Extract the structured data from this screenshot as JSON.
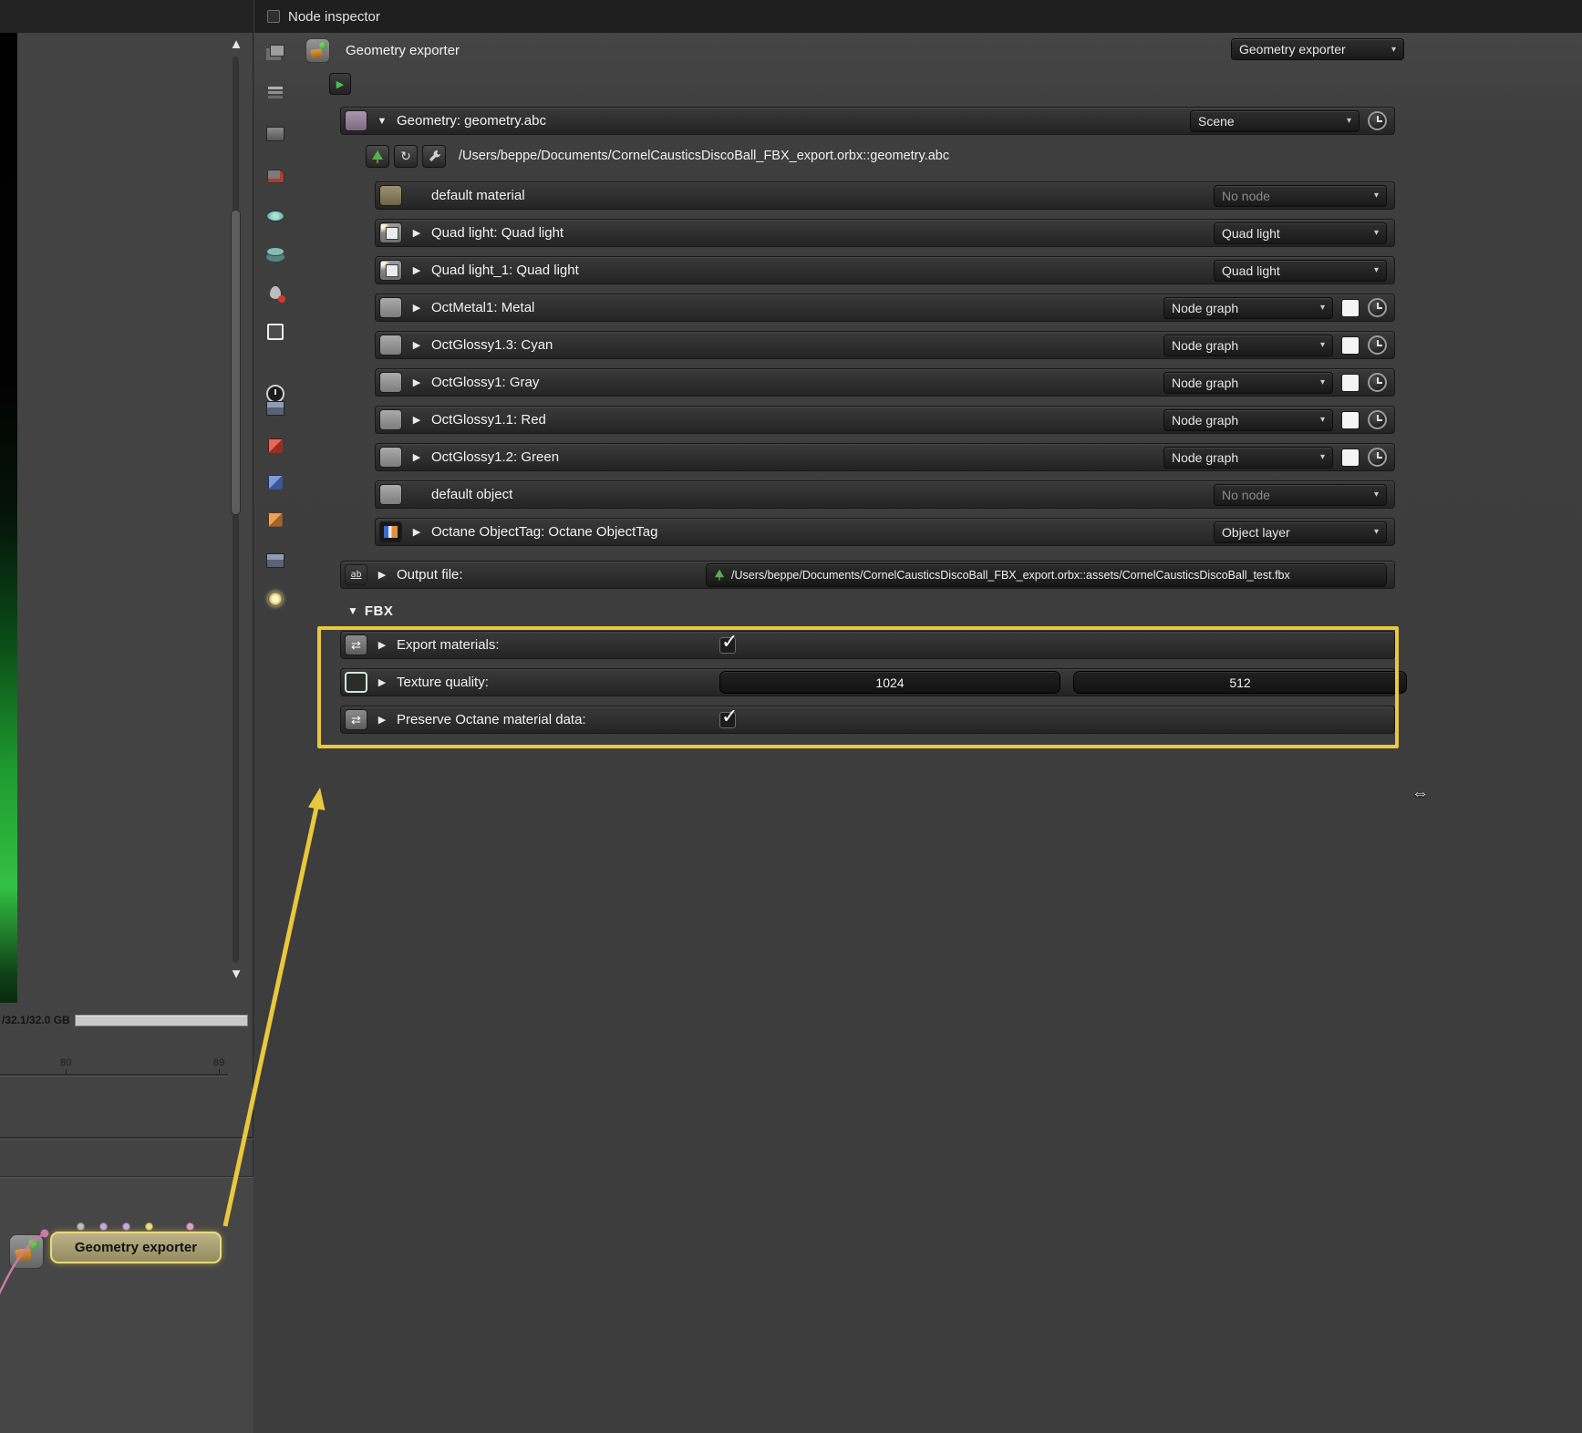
{
  "glyphs": {
    "expand_open": "▼",
    "expand_closed": "▶",
    "caret": "▾",
    "check": "✓",
    "scroll_up": "▲",
    "scroll_down": "▼",
    "play": "▶",
    "refresh": "↻",
    "cursor": "⇔"
  },
  "titlebar": {
    "title": "Node inspector"
  },
  "header": {
    "label": "Geometry exporter",
    "type_value": "Geometry exporter"
  },
  "geometry": {
    "label": "Geometry: geometry.abc",
    "value": "Scene",
    "path": "/Users/beppe/Documents/CornelCausticsDiscoBall_FBX_export.orbx::geometry.abc"
  },
  "children": [
    {
      "label": "default material",
      "value": "No node"
    },
    {
      "label": "Quad light: Quad light",
      "value": "Quad light"
    },
    {
      "label": "Quad light_1: Quad light",
      "value": "Quad light"
    },
    {
      "label": "OctMetal1: Metal",
      "value": "Node graph"
    },
    {
      "label": "OctGlossy1.3: Cyan",
      "value": "Node graph"
    },
    {
      "label": "OctGlossy1: Gray",
      "value": "Node graph"
    },
    {
      "label": "OctGlossy1.1: Red",
      "value": "Node graph"
    },
    {
      "label": "OctGlossy1.2: Green",
      "value": "Node graph"
    },
    {
      "label": "default object",
      "value": "No node"
    },
    {
      "label": "Octane ObjectTag: Octane ObjectTag",
      "value": "Object layer"
    }
  ],
  "output_file": {
    "label": "Output file:",
    "path": "/Users/beppe/Documents/CornelCausticsDiscoBall_FBX_export.orbx::assets/CornelCausticsDiscoBall_test.fbx"
  },
  "fbx": {
    "section_label": "FBX",
    "export_materials_label": "Export materials:",
    "texture_quality_label": "Texture quality:",
    "texture_quality_values": [
      "1024",
      "512"
    ],
    "preserve_label": "Preserve Octane material data:"
  },
  "left_panel": {
    "vram_label": "/32.1/32.0 GB",
    "tick_start": "80",
    "tick_end": "89",
    "node_label": "Geometry exporter"
  },
  "colors": {
    "highlight": "#e9c83d"
  },
  "icons": {
    "toolbar": [
      "copy-node-icon",
      "layer-stack-icon",
      "image-node-icon",
      "render-target-icon",
      "disc-icon",
      "disc-stack-icon",
      "material-drop-icon",
      "texture-square-icon",
      "clock-node-icon",
      "picture-node-icon",
      "red-cube-icon",
      "blue-cube-icon",
      "orange-cube-icon",
      "image-file-icon",
      "sun-node-icon"
    ]
  }
}
